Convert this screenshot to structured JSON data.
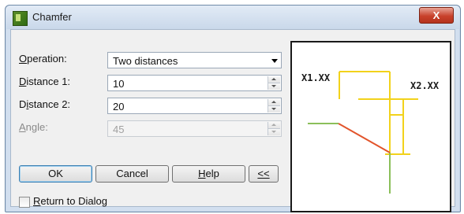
{
  "window": {
    "title": "Chamfer",
    "close_glyph": "X"
  },
  "form": {
    "operation": {
      "label": "Operation:",
      "mnemonic": "O",
      "rest": "peration:",
      "value": "Two distances"
    },
    "distance1": {
      "mnemonic": "D",
      "rest": "istance 1:",
      "value": "10"
    },
    "distance2": {
      "prefix": "D",
      "mnemonic": "i",
      "rest": "stance 2:",
      "value": "20"
    },
    "angle": {
      "mnemonic": "A",
      "rest": "ngle:",
      "value": "45",
      "disabled": true
    }
  },
  "buttons": {
    "ok": "OK",
    "cancel": "Cancel",
    "help_mnemonic": "H",
    "help_rest": "elp",
    "collapse_mnemonic": "<<"
  },
  "return_to_dialog": {
    "mnemonic": "R",
    "rest": "eturn to Dialog",
    "checked": false
  },
  "preview": {
    "x1_label": "X1.XX",
    "x2_label": "X2.XX",
    "colors": {
      "dimension": "#f2d21b",
      "edge": "#8bbf5a",
      "chamfer": "#e2542b"
    }
  }
}
